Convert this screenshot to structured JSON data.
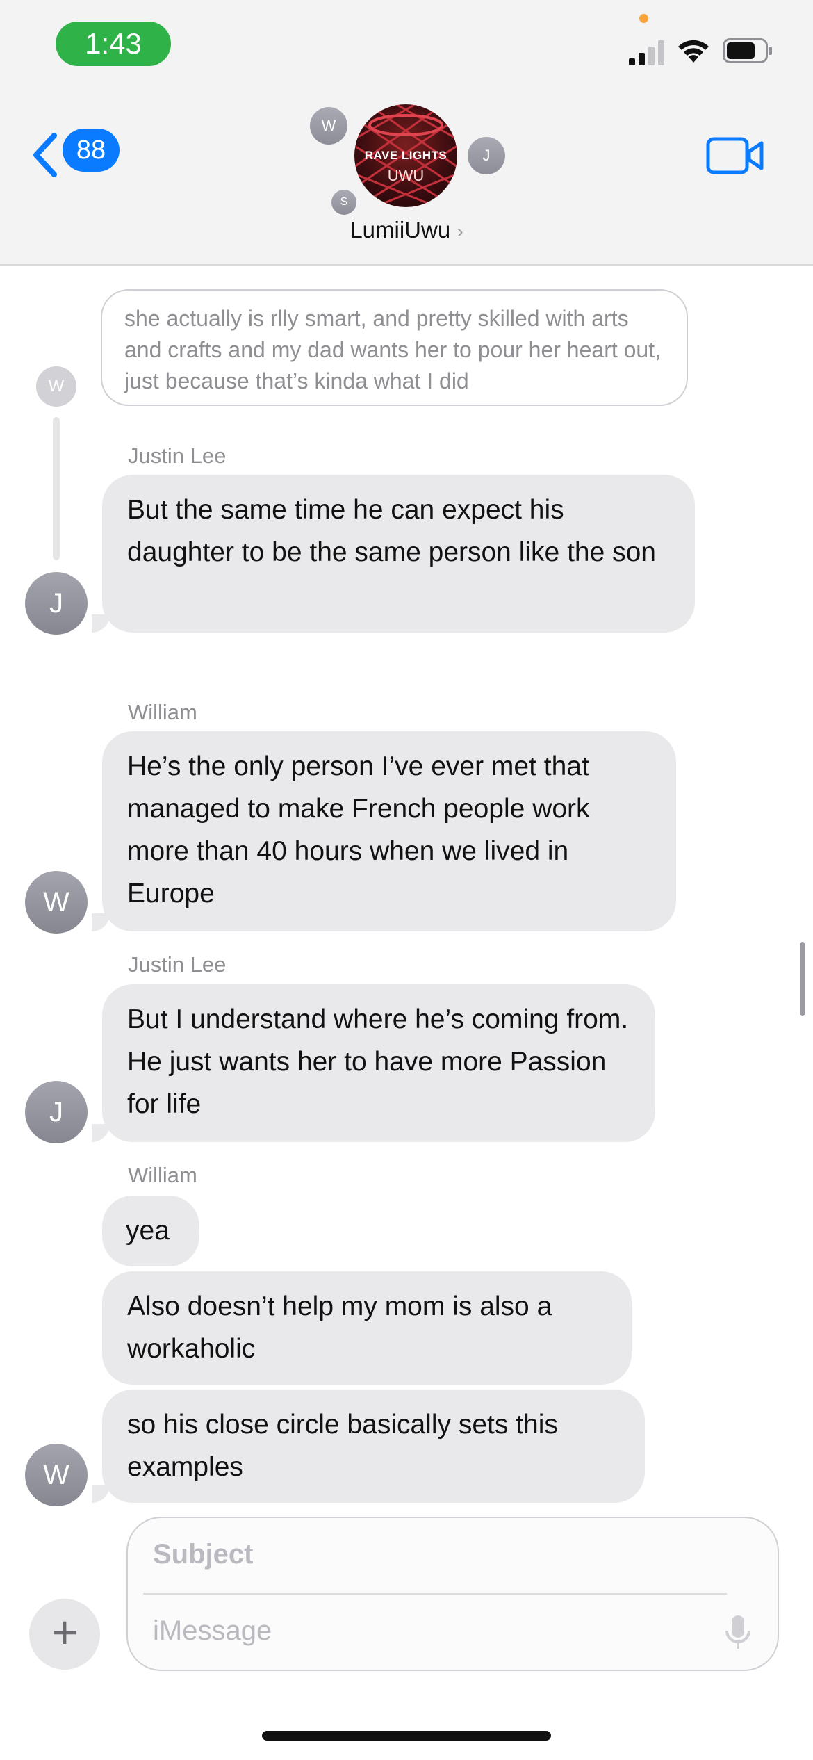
{
  "status_bar": {
    "time": "1:43"
  },
  "header": {
    "back_badge": "88",
    "group_name": "LumiiUwu",
    "group_chevron": "›",
    "avatar_text_line1": "RAVE LIGHTS",
    "avatar_text_line2": "UWU",
    "mini_avatars": [
      "W",
      "J",
      "S"
    ],
    "icons": [
      "back-chevron-icon",
      "video-camera-icon",
      "cellular-signal-icon",
      "wifi-icon",
      "battery-icon"
    ]
  },
  "quoted_message": {
    "avatar": "W",
    "text": "she actually is rlly smart, and pretty skilled with arts and crafts and my dad wants her to pour her heart out, just because that’s kinda what I did"
  },
  "messages": [
    {
      "sender": "Justin Lee",
      "avatar": "J",
      "texts": [
        "But the same time he can expect his daughter to be the same person like the son"
      ]
    },
    {
      "sender": "William",
      "avatar": "W",
      "texts": [
        "He’s the only person I’ve ever met that managed to make French people work more than 40 hours when we lived in Europe"
      ]
    },
    {
      "sender": "Justin Lee",
      "avatar": "J",
      "texts": [
        "But I understand where he’s coming from. He just wants her to have more Passion for life"
      ]
    },
    {
      "sender": "William",
      "avatar": "W",
      "texts": [
        "yea",
        "Also doesn’t help my mom is also a workaholic",
        "so his close circle basically sets this examples"
      ]
    }
  ],
  "input": {
    "plus": "+",
    "subject_placeholder": "Subject",
    "message_placeholder": "iMessage"
  }
}
